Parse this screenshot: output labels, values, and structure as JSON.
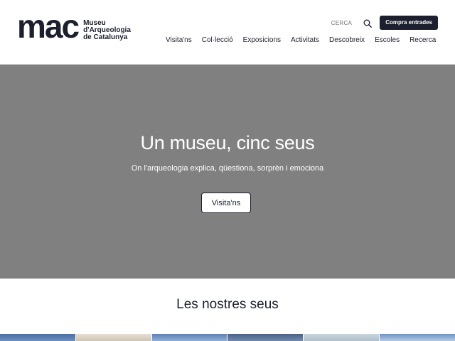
{
  "logo": {
    "mark": "mac",
    "line1": "Museu",
    "line2": "d'Arqueologia",
    "line3": "de Catalunya"
  },
  "utility": {
    "search_label": "CERCA",
    "search_icon": "search-icon",
    "buy_label": "Compra entrades"
  },
  "nav": {
    "items": [
      "Visita'ns",
      "Col·lecció",
      "Exposicions",
      "Activitats",
      "Descobreix",
      "Escoles",
      "Recerca"
    ]
  },
  "hero": {
    "title": "Un museu, cinc seus",
    "subtitle": "On l'arqueologia explica, qüestiona, sorprèn i emociona",
    "button_label": "Visita'ns"
  },
  "sites": {
    "title": "Les nostres seus"
  },
  "colors": {
    "brand_dark": "#1b1f2e",
    "hero_bg": "#808080",
    "white": "#ffffff"
  }
}
